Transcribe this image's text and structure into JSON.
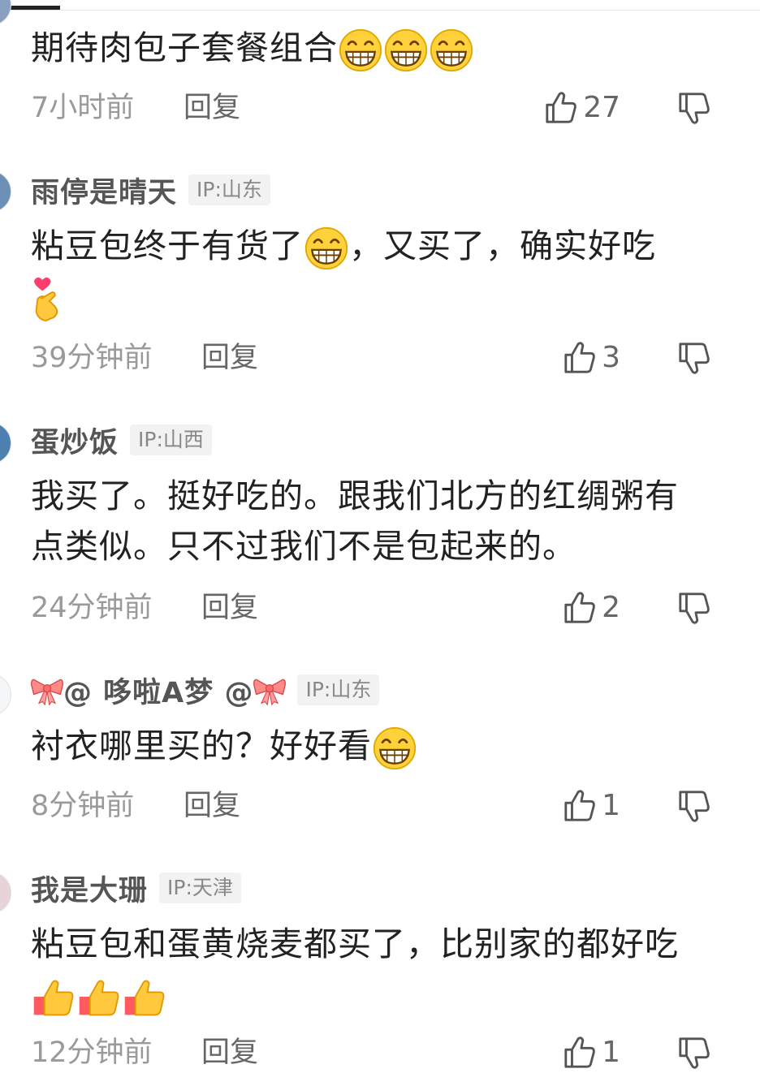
{
  "comments": [
    {
      "username": "",
      "ip": "",
      "text": "期待肉包子套餐组合",
      "time": "7小时前",
      "reply": "回复",
      "likes": "27"
    },
    {
      "username": "雨停是晴天",
      "ip": "IP:山东",
      "text_a": "粘豆包终于有货了",
      "text_b": "，又买了，确实好吃",
      "time": "39分钟前",
      "reply": "回复",
      "likes": "3"
    },
    {
      "username": "蛋炒饭",
      "ip": "IP:山西",
      "text": "我买了。挺好吃的。跟我们北方的红绸粥有点类似。只不过我们不是包起来的。",
      "time": "24分钟前",
      "reply": "回复",
      "likes": "2"
    },
    {
      "username": "@ 哆啦A梦 @",
      "ip": "IP:山东",
      "text": "衬衣哪里买的？好好看",
      "time": "8分钟前",
      "reply": "回复",
      "likes": "1"
    },
    {
      "username": "我是大珊",
      "ip": "IP:天津",
      "text": "粘豆包和蛋黄烧麦都买了，比别家的都好吃",
      "time": "12分钟前",
      "reply": "回复",
      "likes": "1"
    }
  ],
  "icons": {
    "grin": "grinning-face-emoji",
    "heart_hand": "heart-hands-emoji",
    "thumbs_up": "thumbs-up-emoji",
    "bow": "ribbon-emoji",
    "like": "thumbs-up-outline-icon",
    "dislike": "thumbs-down-outline-icon"
  },
  "colors": {
    "text": "#222222",
    "username": "#555555",
    "meta": "#9a9a9a",
    "badge_bg": "#f2f2f2"
  }
}
